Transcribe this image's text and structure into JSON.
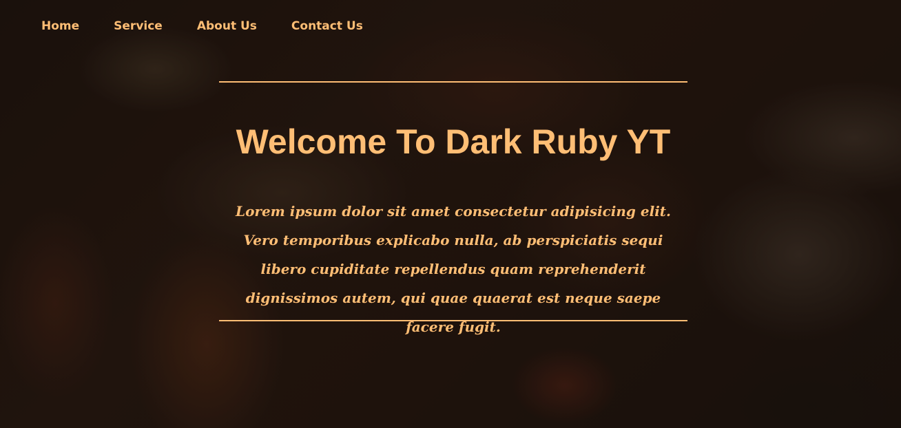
{
  "nav": {
    "items": [
      {
        "label": "Home"
      },
      {
        "label": "Service"
      },
      {
        "label": "About Us"
      },
      {
        "label": "Contact Us"
      }
    ]
  },
  "hero": {
    "title": "Welcome To Dark Ruby YT",
    "description": "Lorem ipsum dolor sit amet consectetur adipisicing elit. Vero temporibus explicabo nulla, ab perspiciatis sequi libero cupiditate repellendus quam reprehenderit dignissimos autem, qui quae quaerat est neque saepe facere fugit."
  },
  "colors": {
    "accent": "#ffbe75",
    "background": "#241711"
  }
}
